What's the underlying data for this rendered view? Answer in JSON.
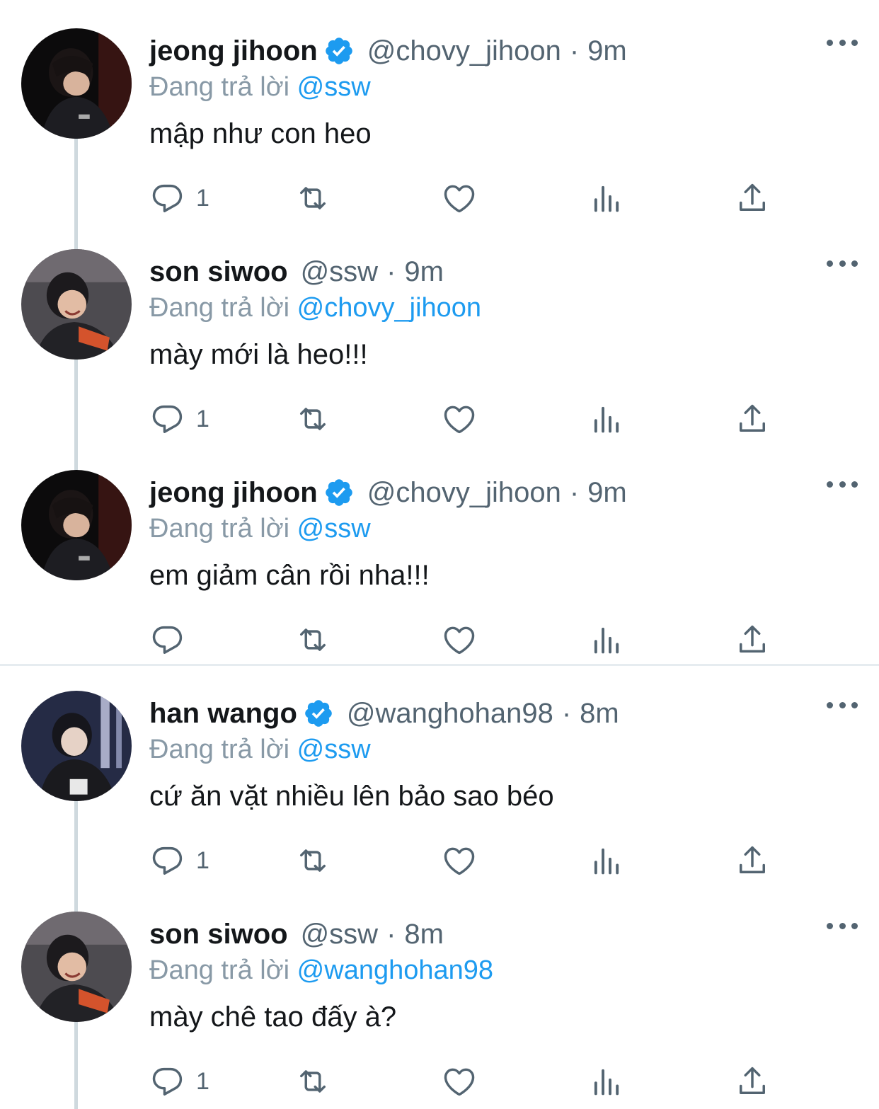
{
  "replying_prefix": "Đang trả lời",
  "separator_after": 2,
  "tweets": [
    {
      "name": "jeong jihoon",
      "verified": true,
      "handle": "@chovy_jihoon",
      "time": "9m",
      "replying_to": "@ssw",
      "text": "mập như con heo",
      "reply_count": "1",
      "avatar": "avatar-jeong-jihoon"
    },
    {
      "name": "son siwoo",
      "verified": false,
      "handle": "@ssw",
      "time": "9m",
      "replying_to": "@chovy_jihoon",
      "text": "mày mới là heo!!!",
      "reply_count": "1",
      "avatar": "avatar-son-siwoo"
    },
    {
      "name": "jeong jihoon",
      "verified": true,
      "handle": "@chovy_jihoon",
      "time": "9m",
      "replying_to": "@ssw",
      "text": "em giảm cân rồi nha!!!",
      "reply_count": "",
      "avatar": "avatar-jeong-jihoon"
    },
    {
      "name": "han wango",
      "verified": true,
      "handle": "@wanghohan98",
      "time": "8m",
      "replying_to": "@ssw",
      "text": "cứ ăn vặt nhiều lên bảo sao béo",
      "reply_count": "1",
      "avatar": "avatar-han-wango"
    },
    {
      "name": "son siwoo",
      "verified": false,
      "handle": "@ssw",
      "time": "8m",
      "replying_to": "@wanghohan98",
      "text": "mày chê tao đấy à?",
      "reply_count": "1",
      "avatar": "avatar-son-siwoo"
    }
  ],
  "colors": {
    "text": "#14171a",
    "secondary": "#536471",
    "reply_prefix": "#8899a6",
    "mention": "#1d9bf0",
    "verified": "#1d9bf0",
    "thread_line": "#cfd9de"
  }
}
